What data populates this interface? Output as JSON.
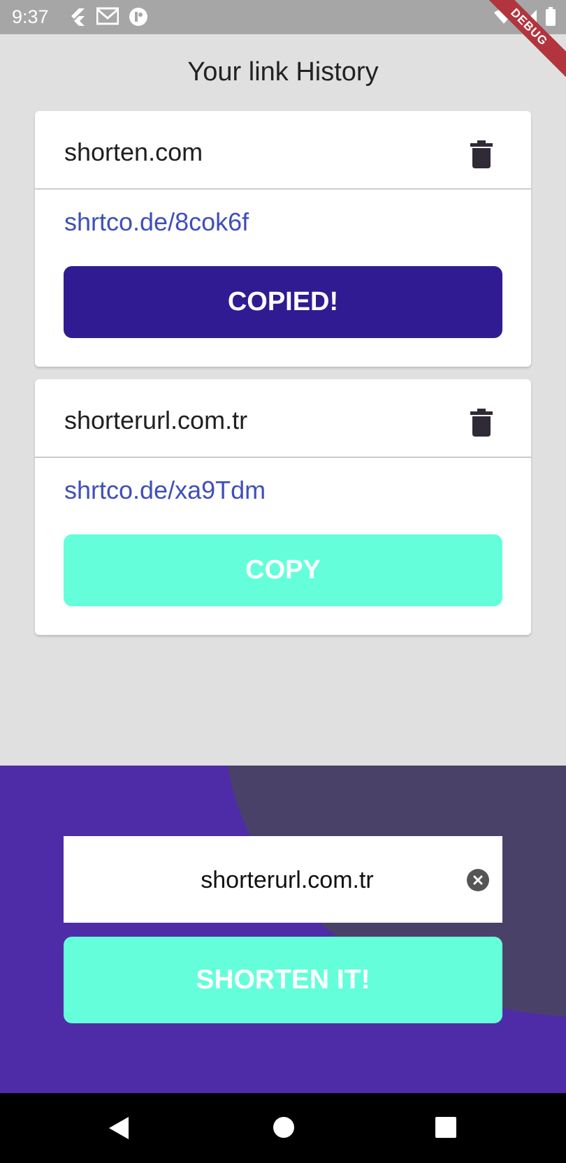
{
  "status_bar": {
    "time": "9:37",
    "icons_left": [
      "flutter-icon",
      "gmail-icon",
      "app-icon"
    ],
    "icons_right": [
      "wifi-icon",
      "signal-icon",
      "battery-icon"
    ],
    "debug_label": "DEBUG"
  },
  "page": {
    "title": "Your link History"
  },
  "history": [
    {
      "original": "shorten.com",
      "short": "shrtco.de/8cok6f",
      "button": "COPIED!",
      "button_color": "#311b92"
    },
    {
      "original": "shorterurl.com.tr",
      "short": "shrtco.de/xa9Tdm",
      "button": "COPY",
      "button_color": "#64ffda"
    }
  ],
  "form": {
    "input_value": "shorterurl.com.tr",
    "submit_label": "SHORTEN IT!",
    "submit_color": "#64ffda"
  },
  "colors": {
    "panel": "#4e2ca8",
    "panel_blob": "#4a4169",
    "link": "#3f4fb9",
    "background": "#e0e0e0"
  }
}
